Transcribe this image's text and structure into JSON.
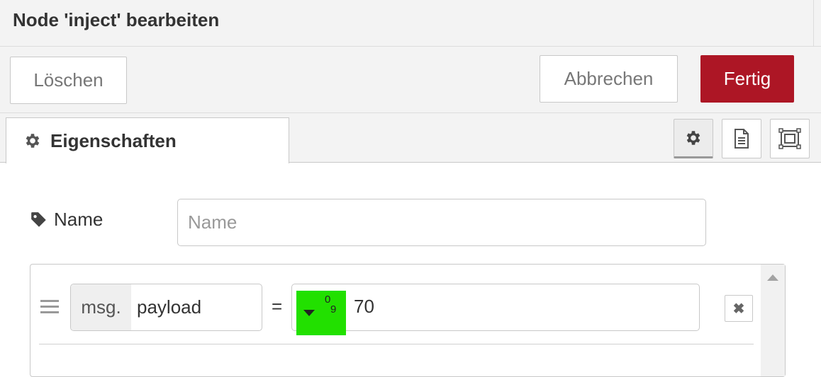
{
  "header": {
    "title": "Node 'inject' bearbeiten"
  },
  "toolbar": {
    "delete_label": "Löschen",
    "cancel_label": "Abbrechen",
    "done_label": "Fertig",
    "done_color": "#ad1625"
  },
  "tabs": {
    "active_label": "Eigenschaften",
    "buttons": [
      {
        "icon": "gear-icon",
        "active": true
      },
      {
        "icon": "document-icon",
        "active": false
      },
      {
        "icon": "appearance-icon",
        "active": false
      }
    ]
  },
  "form": {
    "name_label": "Name",
    "name_placeholder": "Name",
    "name_value": "",
    "property": {
      "prefix": "msg.",
      "name": "payload",
      "equals": "=",
      "type_icon_top": "0",
      "type_icon_bottom": "9",
      "type_highlight_color": "#22e000",
      "value": "70"
    }
  }
}
